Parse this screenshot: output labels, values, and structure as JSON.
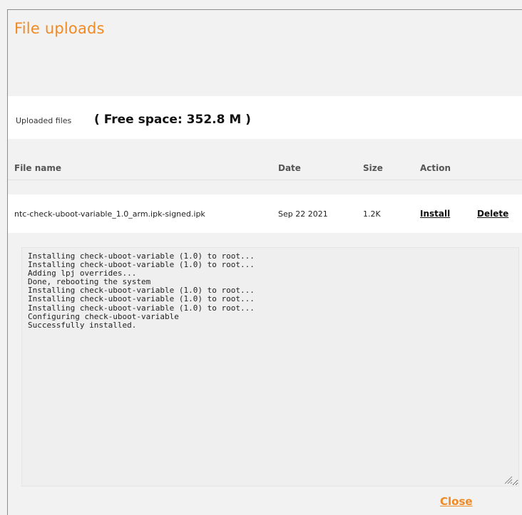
{
  "dialog": {
    "title": "File uploads"
  },
  "uploaded": {
    "label": "Uploaded files",
    "free_space": "( Free space: 352.8 M )"
  },
  "table": {
    "headers": {
      "file_name": "File name",
      "date": "Date",
      "size": "Size",
      "action": "Action"
    },
    "rows": [
      {
        "file_name": "ntc-check-uboot-variable_1.0_arm.ipk-signed.ipk",
        "date": "Sep 22 2021",
        "size": "1.2K",
        "install_label": "Install",
        "delete_label": "Delete"
      }
    ]
  },
  "log": {
    "text": "Installing check-uboot-variable (1.0) to root...\nInstalling check-uboot-variable (1.0) to root...\nAdding lpj overrides...\nDone, rebooting the system\nInstalling check-uboot-variable (1.0) to root...\nInstalling check-uboot-variable (1.0) to root...\nInstalling check-uboot-variable (1.0) to root...\nConfiguring check-uboot-variable\nSuccessfully installed."
  },
  "footer": {
    "close_label": "Close"
  },
  "colors": {
    "accent": "#f08a24",
    "background": "#f2f2f2",
    "band": "#ffffff"
  }
}
